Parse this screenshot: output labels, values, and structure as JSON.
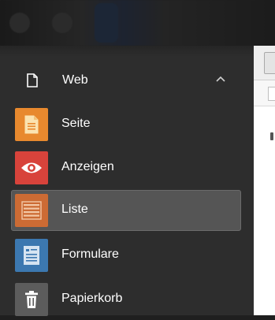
{
  "sidebar": {
    "group": {
      "label": "Web",
      "icon": "page-icon"
    },
    "items": [
      {
        "label": "Seite",
        "icon": "page-icon",
        "color": "#e8892e",
        "active": false
      },
      {
        "label": "Anzeigen",
        "icon": "eye-icon",
        "color": "#d8433b",
        "active": false
      },
      {
        "label": "Liste",
        "icon": "list-icon",
        "color": "#cc6b34",
        "active": true
      },
      {
        "label": "Formulare",
        "icon": "form-icon",
        "color": "#3c78b0",
        "active": false
      },
      {
        "label": "Papierkorb",
        "icon": "trash-icon",
        "color": "#5c5c5c",
        "active": false
      }
    ]
  },
  "colors": {
    "sidebar_bg": "#2d2d2d",
    "active_bg": "#555555",
    "text": "#ffffff"
  }
}
